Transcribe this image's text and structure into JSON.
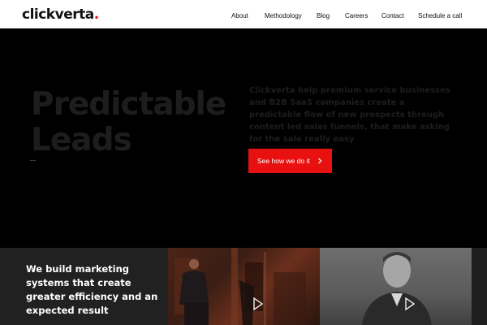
{
  "header": {
    "logo_text": "clickverta",
    "logo_dot": ".",
    "nav": {
      "about": "About",
      "methodology": "Methodology",
      "blog": "Blog",
      "careers": "Careers",
      "contact": "Contact",
      "schedule": "Schedule a call"
    }
  },
  "hero": {
    "title_line1": "Predictable",
    "title_line2": "Leads",
    "description": "Clickverta help premium service businesses and B2B SaaS companies create a predictable flow of new prospects through content led sales funnels, that make asking for the sale really easy",
    "cta_label": "See how we do it",
    "cta_icon": "chevron-right-icon"
  },
  "band": {
    "heading": "We build marketing systems that create greater efficiency and an expected result",
    "video_icon": "play-icon"
  },
  "colors": {
    "accent": "#e8110f",
    "hero_bg": "#000000",
    "hero_text": "#1d1d1d",
    "band_panel": "#212121"
  }
}
